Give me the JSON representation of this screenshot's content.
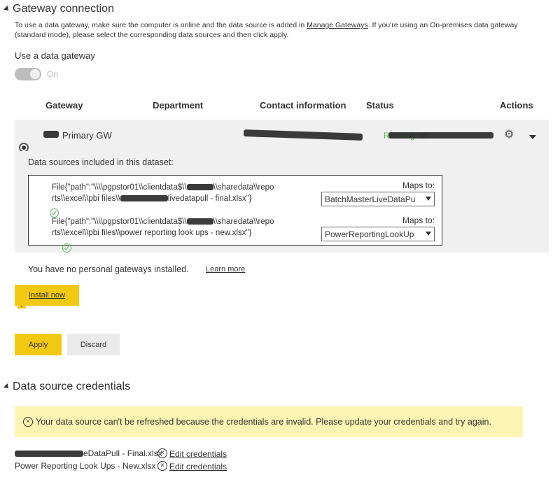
{
  "gateway_section": {
    "title": "Gateway connection",
    "description_prefix": "To use a data gateway, make sure the computer is online and the data source is added in ",
    "manage_link": "Manage Gateways",
    "description_suffix": ". If you're using an On-premises data gateway (standard mode), please select the corresponding data sources and then click apply.",
    "use_gateway_label": "Use a data gateway",
    "toggle_state": "On"
  },
  "table": {
    "headers": {
      "gateway": "Gateway",
      "department": "Department",
      "contact": "Contact information",
      "status": "Status",
      "actions": "Actions"
    },
    "row": {
      "name": "Primary GW",
      "status": "Running on"
    }
  },
  "datasources": {
    "heading": "Data sources included in this dataset:",
    "items": [
      {
        "path_line1": "File{\"path\":\"\\\\\\\\pgpstor01\\\\clientdata$\\\\",
        "path_line1_end": "\\\\sharedata\\\\repo",
        "path_line2_start": "rts\\\\excel\\\\pbi files\\\\",
        "path_line2_end": "livedatapull - final.xlsx\"}",
        "maps_label": "Maps to:",
        "selected": "BatchMasterLiveDataPu"
      },
      {
        "path_line1": "File{\"path\":\"\\\\\\\\pgpstor01\\\\clientdata$\\\\",
        "path_line1_end": "\\\\sharedata\\\\repo",
        "path_line2": "rts\\\\excel\\\\pbi files\\\\power reporting look ups - new.xlsx\"}",
        "maps_label": "Maps to:",
        "selected": "PowerReportingLookUp"
      }
    ]
  },
  "personal": {
    "warning": "You have no personal gateways installed.",
    "learn_more": "Learn more",
    "install_label": "Install now"
  },
  "buttons": {
    "apply": "Apply",
    "discard": "Discard"
  },
  "credentials": {
    "title": "Data source credentials",
    "banner": "Your data source can't be refreshed because the credentials are invalid. Please update your credentials and try again.",
    "items": [
      {
        "name_suffix": "eDataPull - Final.xlsx",
        "edit_label": "Edit credentials"
      },
      {
        "name": "Power Reporting Look Ups - New.xlsx",
        "edit_label": "Edit credentials"
      }
    ]
  },
  "colors": {
    "accent_yellow": "#f2c811",
    "banner_yellow": "#fcf4b2",
    "ok_green": "#5cb85c",
    "panel_gray": "#f0f0f0"
  }
}
